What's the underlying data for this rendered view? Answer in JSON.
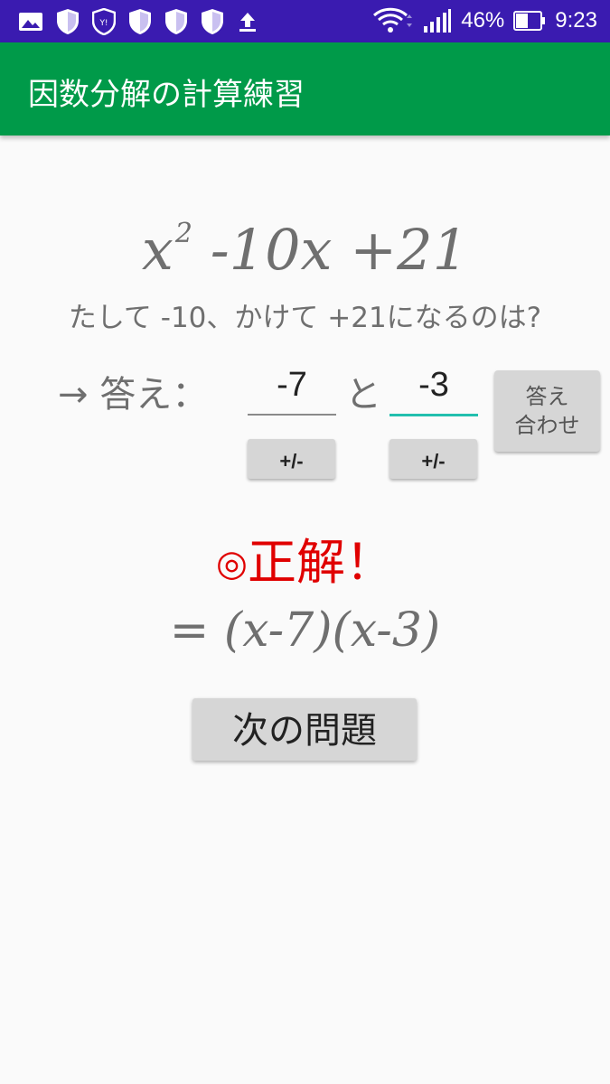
{
  "status_bar": {
    "battery_percent": "46%",
    "time": "9:23",
    "icons": [
      "gallery-icon",
      "shield-icon",
      "yahoo-shield-icon",
      "shield-icon",
      "shield-icon",
      "shield-icon",
      "upload-icon",
      "wifi-icon",
      "signal-icon",
      "battery-icon"
    ]
  },
  "app_bar": {
    "title": "因数分解の計算練習",
    "color": "#009a49"
  },
  "problem": {
    "x": "x",
    "exponent": "2",
    "rest": " -10x +21"
  },
  "hint": "たして -10、かけて +21になるのは?",
  "answer": {
    "label": "→ 答え：",
    "value1": "-7",
    "connector": "と",
    "value2": "-3",
    "sign_button_label": "+/-",
    "check_button_line1": "答え",
    "check_button_line2": "合わせ"
  },
  "feedback": {
    "mark": "◎",
    "text": "正解！",
    "color": "#e00000"
  },
  "result": {
    "equals": "=",
    "expression": "(x-7)(x-3)"
  },
  "next_button": "次の問題"
}
